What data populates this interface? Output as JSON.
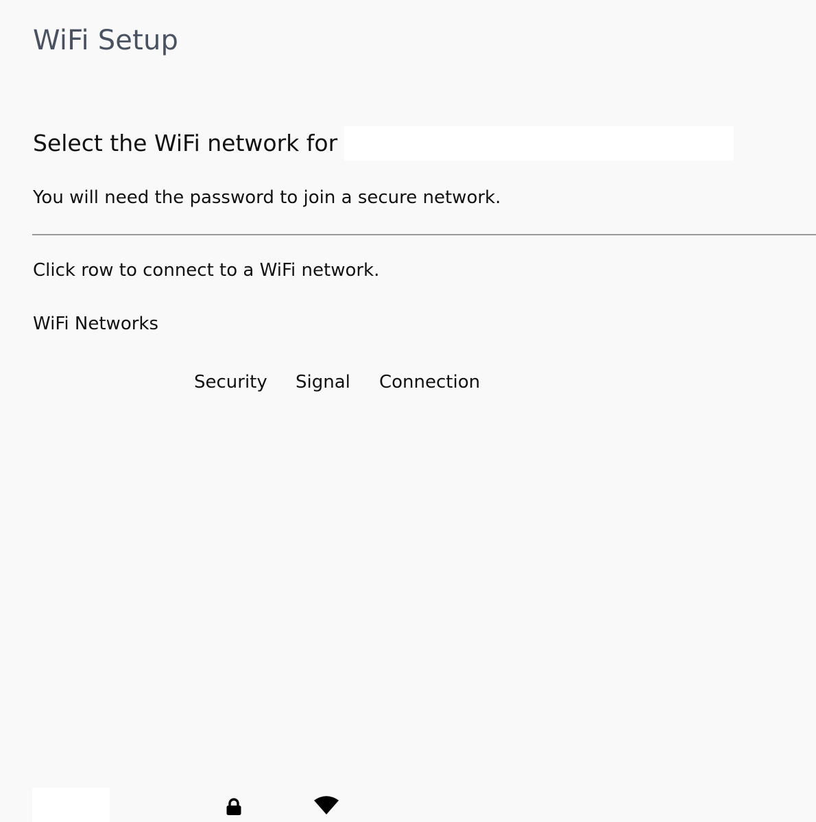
{
  "page": {
    "title": "WiFi Setup"
  },
  "setup": {
    "heading": "Select the WiFi network for",
    "device_name": "",
    "instruction": "You will need the password to join a secure network.",
    "click_hint": "Click row to connect to a WiFi network."
  },
  "networks": {
    "title": "WiFi Networks",
    "columns": {
      "ssid": "",
      "security": "Security",
      "signal": "Signal",
      "connection": "Connection"
    },
    "rows": [
      {
        "ssid": "",
        "security_icon": "lock-icon",
        "signal_icon": "wifi-signal-icon",
        "connection": ""
      }
    ]
  }
}
